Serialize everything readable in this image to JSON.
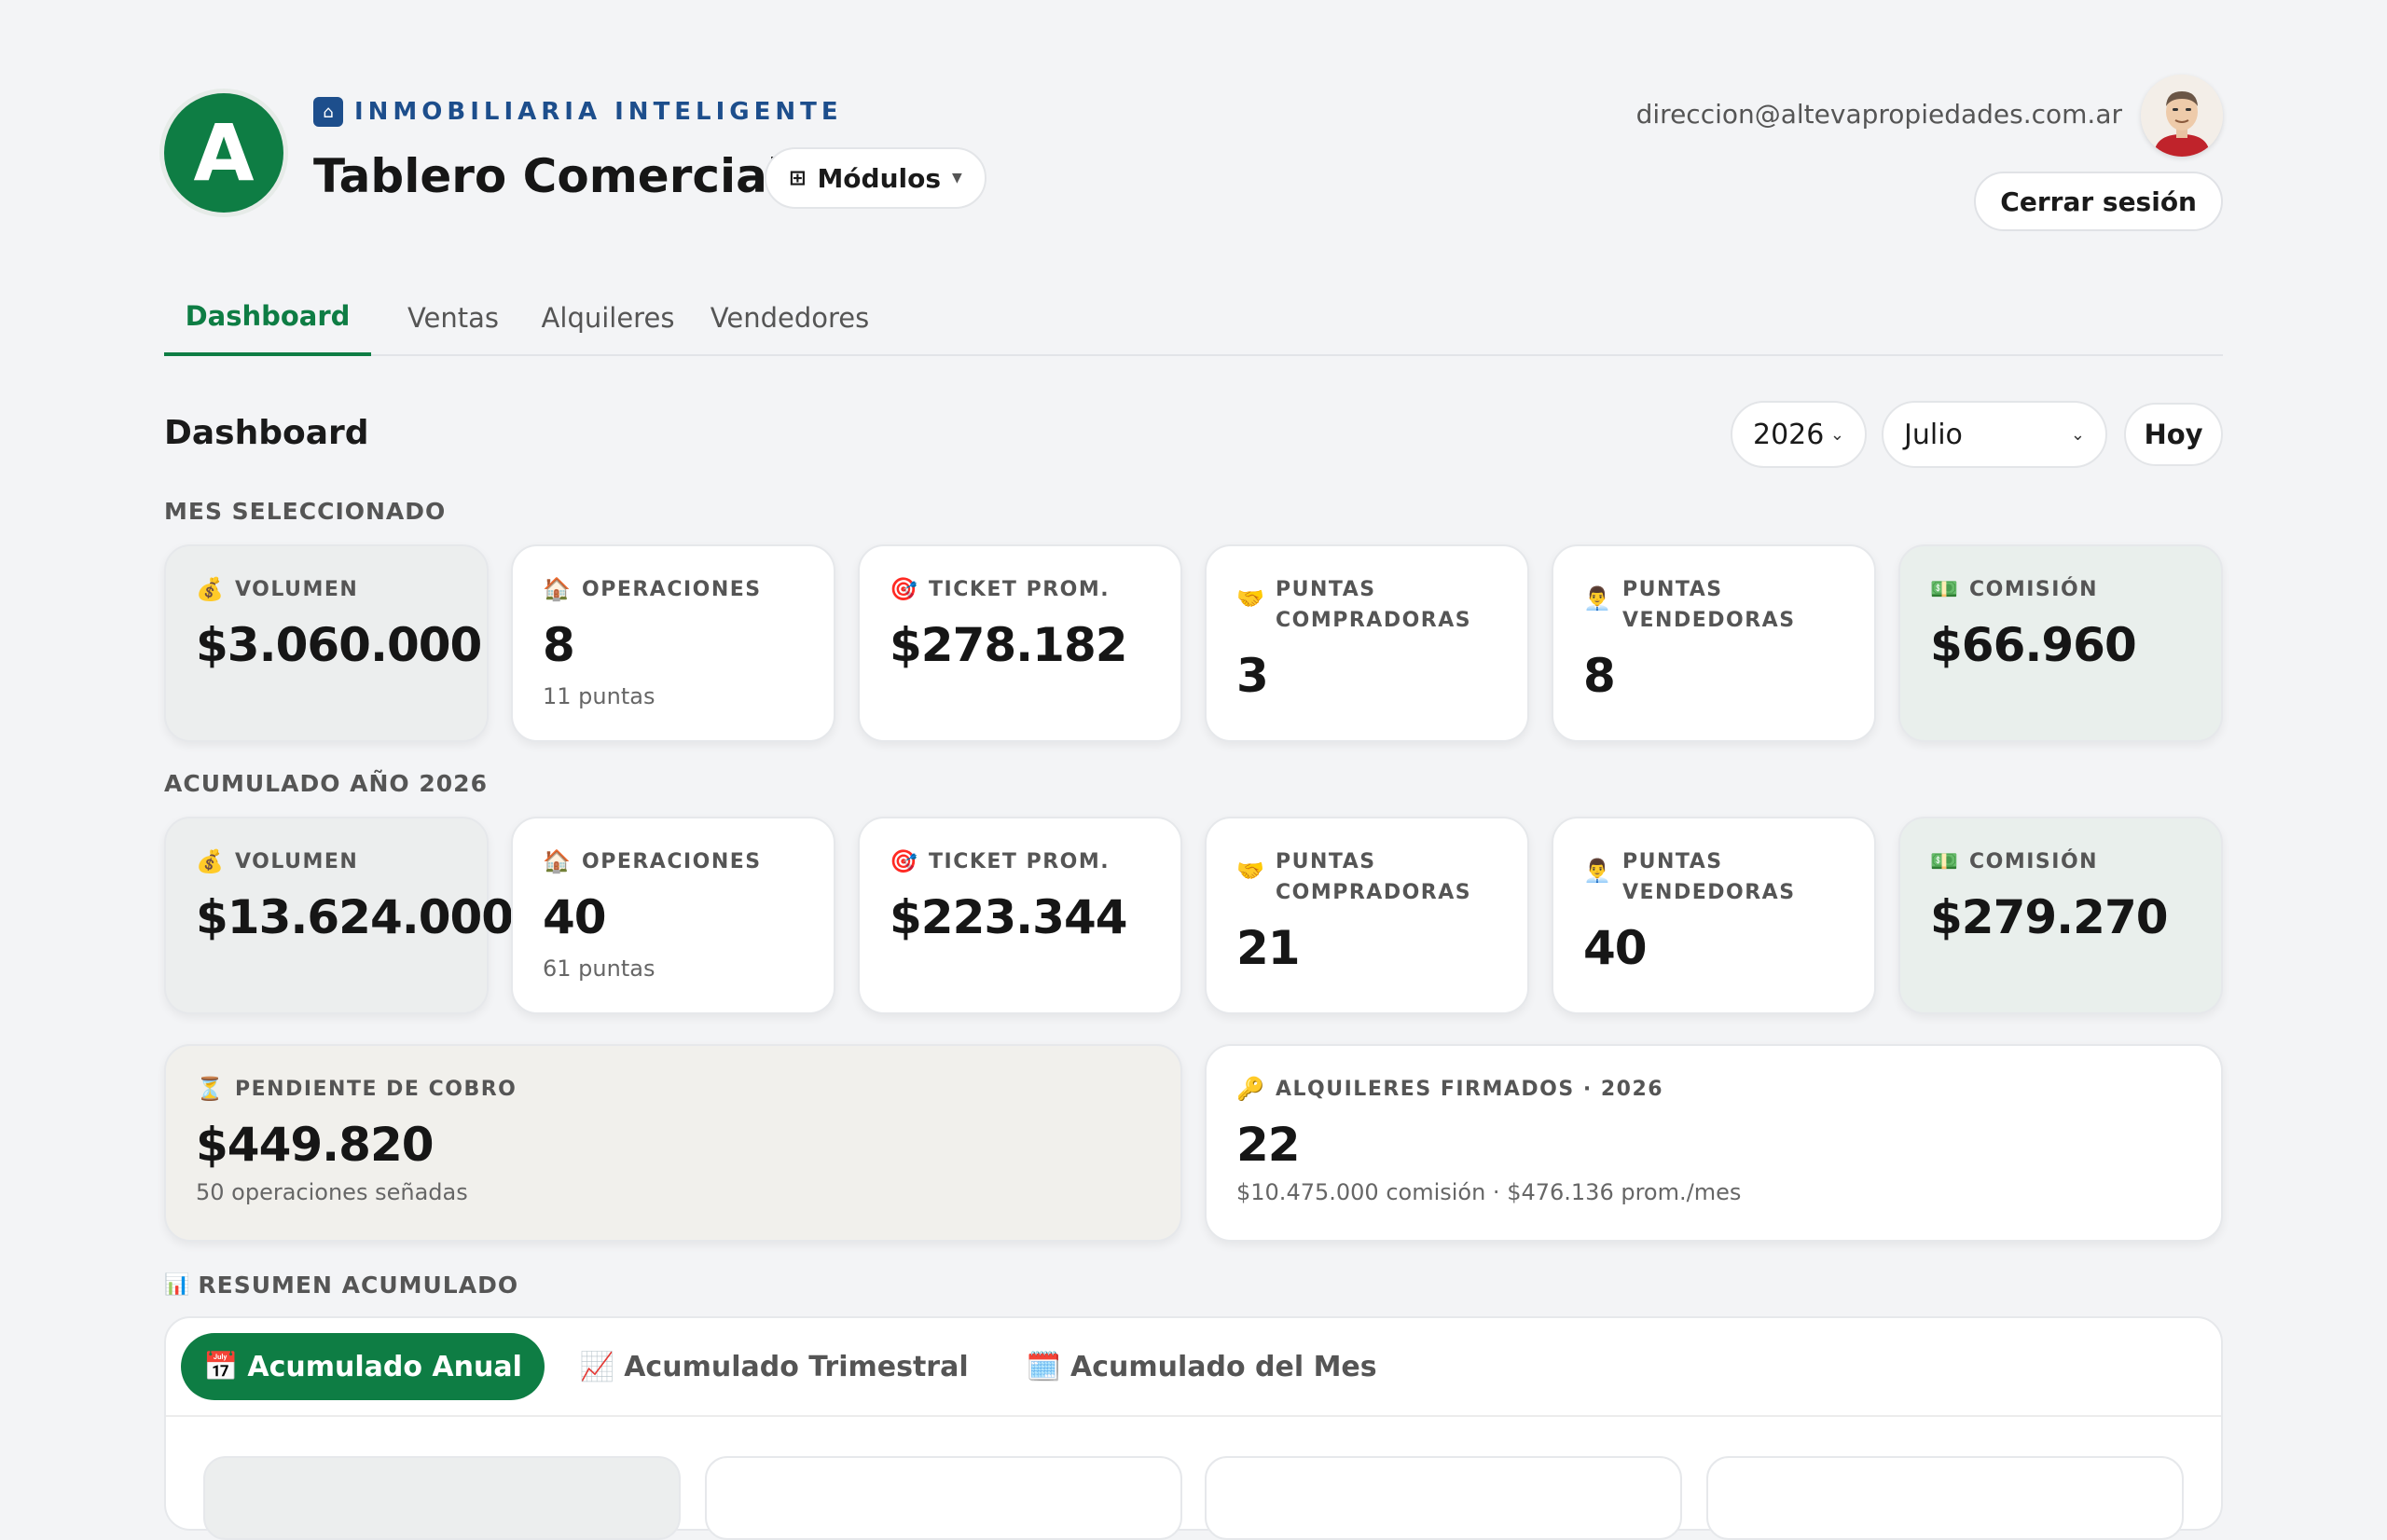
{
  "header": {
    "logo_letter": "A",
    "brand": "INMOBILIARIA INTELIGENTE",
    "title": "Tablero Comercial",
    "modules_label": "Módulos",
    "user_email": "direccion@altevapropiedades.com.ar",
    "logout_label": "Cerrar sesión"
  },
  "nav": {
    "tabs": [
      {
        "label": "Dashboard",
        "active": true
      },
      {
        "label": "Ventas"
      },
      {
        "label": "Alquileres"
      },
      {
        "label": "Vendedores"
      }
    ]
  },
  "dashboard": {
    "title": "Dashboard",
    "year": "2026",
    "month": "Julio",
    "today_label": "Hoy"
  },
  "month_section": {
    "label": "MES SELECCIONADO",
    "cards": [
      {
        "icon": "money-bag-icon",
        "label": "VOLUMEN",
        "value": "$3.060.000"
      },
      {
        "icon": "house-icon",
        "label": "OPERACIONES",
        "value": "8",
        "sub": "11 puntas"
      },
      {
        "icon": "target-icon",
        "label": "TICKET PROM.",
        "value": "$278.182"
      },
      {
        "icon": "handshake-icon",
        "label": "PUNTAS COMPRADORAS",
        "value": "3"
      },
      {
        "icon": "salesperson-icon",
        "label": "PUNTAS VENDEDORAS",
        "value": "8"
      },
      {
        "icon": "cash-icon",
        "label": "COMISIÓN",
        "value": "$66.960"
      }
    ]
  },
  "year_section": {
    "label": "ACUMULADO AÑO 2026",
    "cards": [
      {
        "icon": "money-bag-icon",
        "label": "VOLUMEN",
        "value": "$13.624.000"
      },
      {
        "icon": "house-icon",
        "label": "OPERACIONES",
        "value": "40",
        "sub": "61 puntas"
      },
      {
        "icon": "target-icon",
        "label": "TICKET PROM.",
        "value": "$223.344"
      },
      {
        "icon": "handshake-icon",
        "label": "PUNTAS COMPRADORAS",
        "value": "21"
      },
      {
        "icon": "salesperson-icon",
        "label": "PUNTAS VENDEDORAS",
        "value": "40"
      },
      {
        "icon": "cash-icon",
        "label": "COMISIÓN",
        "value": "$279.270"
      }
    ]
  },
  "pending": {
    "icon": "hourglass-icon",
    "label": "PENDIENTE DE COBRO",
    "value": "$449.820",
    "sub": "50 operaciones señadas"
  },
  "rentals": {
    "icon": "key-icon",
    "label": "ALQUILERES FIRMADOS · 2026",
    "value": "22",
    "sub": "$10.475.000 comisión · $476.136 prom./mes"
  },
  "summary": {
    "label": "RESUMEN ACUMULADO",
    "tabs": [
      {
        "label": "Acumulado Anual",
        "active": true
      },
      {
        "label": "Acumulado Trimestral"
      },
      {
        "label": "Acumulado del Mes"
      }
    ]
  }
}
